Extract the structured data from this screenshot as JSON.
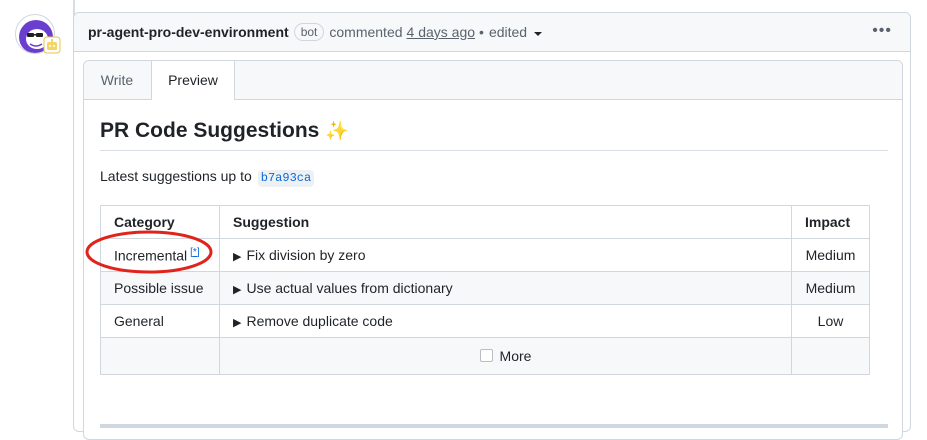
{
  "comment": {
    "author": "pr-agent-pro-dev-environment",
    "bot_label": "bot",
    "action_text": "commented",
    "timestamp": "4 days ago",
    "separator": "•",
    "edited_text": "edited",
    "more_options_icon": "kebab-horizontal-icon"
  },
  "editor": {
    "tabs": [
      {
        "label": "Write",
        "selected": false
      },
      {
        "label": "Preview",
        "selected": true
      }
    ]
  },
  "preview": {
    "heading": "PR Code Suggestions",
    "heading_emoji": "✨",
    "latest_text": "Latest suggestions up to",
    "commit_hash": "b7a93ca",
    "table": {
      "headers": {
        "category": "Category",
        "suggestion": "Suggestion",
        "impact": "Impact"
      },
      "rows": [
        {
          "category": "Incremental",
          "footnote": "[*]",
          "suggestion": "Fix division by zero",
          "impact": "Medium"
        },
        {
          "category": "Possible issue",
          "suggestion": "Use actual values from dictionary",
          "impact": "Medium"
        },
        {
          "category": "General",
          "suggestion": "Remove duplicate code",
          "impact": "Low"
        }
      ],
      "more_label": "More"
    }
  },
  "annotation": {
    "color": "#e0241b"
  },
  "colors": {
    "link": "#0969da",
    "border": "#d0d7de",
    "header_bg": "#f6f8fa",
    "text": "#1f2328",
    "muted": "#59636e"
  }
}
